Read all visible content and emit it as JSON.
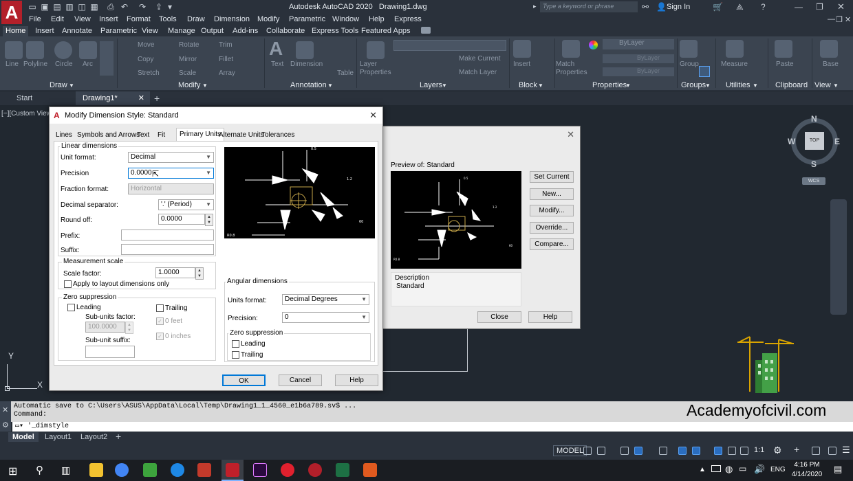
{
  "app": {
    "title": "Autodesk AutoCAD 2020",
    "file": "Drawing1.dwg",
    "logo_letter": "A",
    "search_placeholder": "Type a keyword or phrase",
    "sign_in": "Sign In"
  },
  "menu": [
    "File",
    "Edit",
    "View",
    "Insert",
    "Format",
    "Tools",
    "Draw",
    "Dimension",
    "Modify",
    "Parametric",
    "Window",
    "Help",
    "Express"
  ],
  "ribbon_tabs": [
    "Home",
    "Insert",
    "Annotate",
    "Parametric",
    "View",
    "Manage",
    "Output",
    "Add-ins",
    "Collaborate",
    "Express Tools",
    "Featured Apps"
  ],
  "ribbon_active_tab": "Home",
  "ribbon_panels": {
    "draw": {
      "title": "Draw",
      "tools": [
        "Line",
        "Polyline",
        "Circle",
        "Arc"
      ]
    },
    "modify": {
      "title": "Modify",
      "tools": [
        "Move",
        "Rotate",
        "Trim",
        "Copy",
        "Mirror",
        "Fillet",
        "Stretch",
        "Scale",
        "Array"
      ]
    },
    "annotation": {
      "title": "Annotation",
      "tools": [
        "Text",
        "Dimension",
        "Table"
      ]
    },
    "layers": {
      "title": "Layers",
      "tools": [
        "Layer Properties",
        "Make Current",
        "Match Layer"
      ]
    },
    "block": {
      "title": "Block",
      "tools": [
        "Insert"
      ]
    },
    "properties": {
      "title": "Properties",
      "tools": [
        "Match Properties",
        "ByLayer",
        "ByLayer",
        "ByLayer"
      ]
    },
    "groups": {
      "title": "Groups",
      "tools": [
        "Group"
      ]
    },
    "utilities": {
      "title": "Utilities",
      "tools": [
        "Measure"
      ]
    },
    "clipboard": {
      "title": "Clipboard",
      "tools": [
        "Paste"
      ]
    },
    "view": {
      "title": "View",
      "tools": [
        "Base"
      ]
    }
  },
  "doc_tabs": {
    "start": "Start",
    "drawing": "Drawing1*"
  },
  "viewport_label": "[−][Custom View",
  "viewcube": {
    "n": "N",
    "s": "S",
    "e": "E",
    "w": "W",
    "top": "TOP",
    "wcs": "WCS"
  },
  "ucs": {
    "x": "X",
    "y": "Y"
  },
  "watermark": "Academyofcivil.com",
  "dim_manager": {
    "preview_label": "Preview of: Standard",
    "description_label": "Description",
    "description_value": "Standard",
    "buttons": [
      "Set Current",
      "New...",
      "Modify...",
      "Override...",
      "Compare..."
    ],
    "close": "Close",
    "help": "Help"
  },
  "modify_dialog": {
    "title": "Modify Dimension Style: Standard",
    "tabs": [
      "Lines",
      "Symbols and Arrows",
      "Text",
      "Fit",
      "Primary Units",
      "Alternate Units",
      "Tolerances"
    ],
    "active_tab": "Primary Units",
    "linear": {
      "group_title": "Linear dimensions",
      "unit_format_label": "Unit format:",
      "unit_format_value": "Decimal",
      "precision_label": "Precision",
      "precision_value": "0.0000",
      "fraction_label": "Fraction format:",
      "fraction_value": "Horizontal",
      "decimal_sep_label": "Decimal separator:",
      "decimal_sep_value": "'.' (Period)",
      "round_off_label": "Round off:",
      "round_off_value": "0.0000",
      "prefix_label": "Prefix:",
      "suffix_label": "Suffix:"
    },
    "measurement": {
      "title": "Measurement scale",
      "scale_label": "Scale factor:",
      "scale_value": "1.0000",
      "apply_label": "Apply to layout dimensions only"
    },
    "zero_suppression": {
      "title": "Zero suppression",
      "leading": "Leading",
      "trailing": "Trailing",
      "sub_units_factor_label": "Sub-units factor:",
      "sub_units_factor_value": "100.0000",
      "sub_unit_suffix_label": "Sub-unit suffix:",
      "feet": "0 feet",
      "inches": "0 inches"
    },
    "angular": {
      "title": "Angular dimensions",
      "units_label": "Units format:",
      "units_value": "Decimal Degrees",
      "precision_label": "Precision:",
      "precision_value": "0",
      "zero_title": "Zero suppression",
      "leading": "Leading",
      "trailing": "Trailing"
    },
    "buttons": {
      "ok": "OK",
      "cancel": "Cancel",
      "help": "Help"
    }
  },
  "command": {
    "history": "Automatic save to C:\\Users\\ASUS\\AppData\\Local\\Temp\\Drawing1_1_4560_e1b6a789.sv$ ...",
    "prompt": "Command:",
    "input": "'_dimstyle"
  },
  "layout_tabs": [
    "Model",
    "Layout1",
    "Layout2"
  ],
  "status": {
    "model": "MODEL",
    "scale": "1:1"
  },
  "clock": {
    "time": "4:16 PM",
    "date": "4/14/2020",
    "lang": "ENG"
  }
}
